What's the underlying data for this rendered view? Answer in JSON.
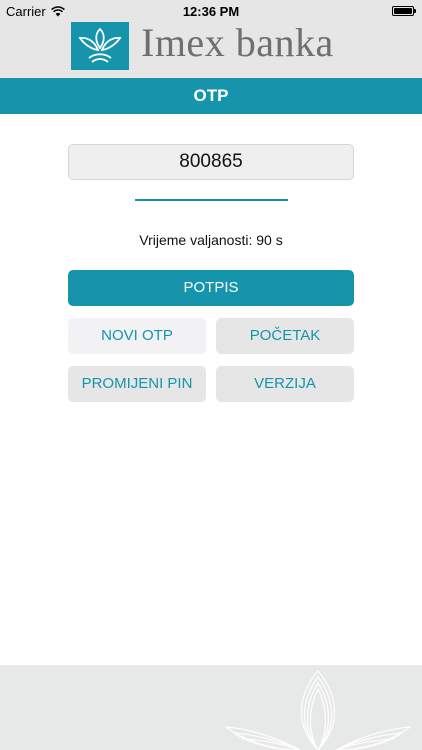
{
  "status_bar": {
    "carrier": "Carrier",
    "time": "12:36 PM",
    "battery_level": 1.0
  },
  "header": {
    "brand_name": "Imex banka",
    "logo_color": "#1594ac"
  },
  "title_bar": {
    "title": "OTP"
  },
  "otp": {
    "code": "800865",
    "validity_label": "Vrijeme valjanosti: 90 s",
    "progress": 1.0
  },
  "buttons": {
    "sign": "POTPIS",
    "new_otp": "NOVI OTP",
    "start": "POČETAK",
    "change_pin": "PROMIJENI PIN",
    "version": "VERZIJA"
  },
  "colors": {
    "accent": "#1594ac",
    "header_bg": "#e6e6e6",
    "brand_text": "#6d6f70"
  },
  "icons": {
    "wifi": "wifi-icon",
    "battery": "battery-icon",
    "logo": "leaf-logo-icon",
    "footer_pattern": "leaf-pattern-icon"
  }
}
